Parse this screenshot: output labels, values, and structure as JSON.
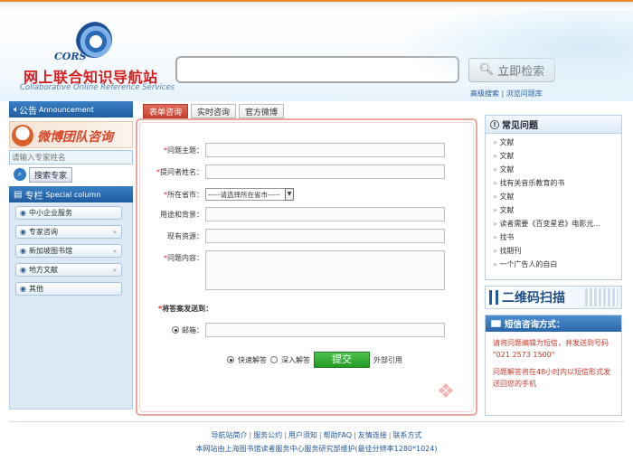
{
  "brand": {
    "logo_mark": "CORS",
    "title_cn": "网上联合知识导航站",
    "title_en": "Collaborative Online Reference Services"
  },
  "search": {
    "value": "",
    "button_label": "立即检索",
    "advanced_link": "高级搜索",
    "separator": " | ",
    "browse_link": "浏览问题库"
  },
  "left": {
    "announcement_cn": "公告",
    "announcement_en": "Announcement",
    "weibo_label": "微博团队咨询",
    "expert_placeholder": "请输入专家姓名",
    "expert_search_button": "搜索专家",
    "special_cn": "专栏",
    "special_en": "Special column",
    "special_items": [
      {
        "label": "中小企业服务",
        "has_arrow": false
      },
      {
        "label": "专家咨询",
        "has_arrow": true
      },
      {
        "label": "新加坡图书馆",
        "has_arrow": true
      },
      {
        "label": "地方文献",
        "has_arrow": true
      },
      {
        "label": "其他",
        "has_arrow": false
      }
    ]
  },
  "tabs": [
    "表单咨询",
    "实时咨询",
    "官方微博"
  ],
  "form": {
    "subject_label": "问题主题：",
    "asker_label": "提问者姓名：",
    "province_label": "所在省市：",
    "province_select": "-----请选择所在省市-----",
    "purpose_label": "用途和背景：",
    "resources_label": "现有资源：",
    "content_label": "问题内容：",
    "send_to_label": "将答案发送到：",
    "email_label": "邮箱：",
    "quick_answer": "快速解答",
    "deep_answer": "深入解答",
    "submit": "提交",
    "external_quote": "外部引用",
    "required_mark": "*"
  },
  "faq": {
    "title": "常见问题",
    "items": [
      "文献",
      "文献",
      "文献",
      "找有关音乐教育的书",
      "文献",
      "文献",
      "读者需要《百变星君》电影光...",
      "找书",
      "找期刊",
      "一个广告人的自白"
    ]
  },
  "qr_banner": "二维码扫描",
  "sms": {
    "title": "短信咨询方式：",
    "line1": "请将问题编辑为短信，并发送到号码 \"021 2573 1500\"",
    "line2": "问题解答将在48小时内以短信形式发送回您的手机"
  },
  "footer": {
    "links": [
      "导航站简介",
      "服务公约",
      "用户须知",
      "帮助FAQ",
      "友情连接",
      "联系方式"
    ],
    "note": "本网站由上海图书馆读者服务中心服务研究部维护(最佳分辨率1280*1024)"
  },
  "colors": {
    "accent_red": "#d81e1e",
    "nav_blue": "#1f5c9e",
    "submit_green": "#239a23",
    "active_tab": "#c9432f"
  }
}
